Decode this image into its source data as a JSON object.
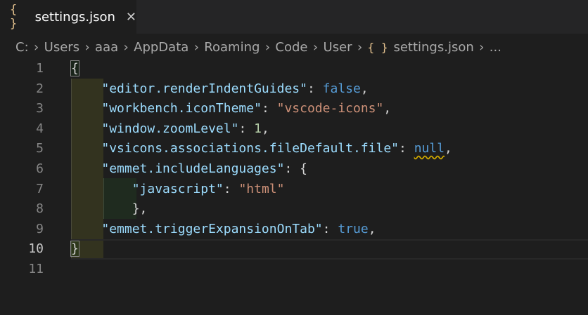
{
  "tab": {
    "icon": "{ }",
    "title": "settings.json",
    "close": "✕"
  },
  "breadcrumb": {
    "items": [
      "C:",
      "Users",
      "aaa",
      "AppData",
      "Roaming",
      "Code",
      "User"
    ],
    "file_icon": "{ }",
    "file": "settings.json",
    "ellipsis": "..."
  },
  "editor": {
    "lines": [
      {
        "n": "1",
        "tokens": [
          {
            "t": "p",
            "v": "{"
          }
        ]
      },
      {
        "n": "2",
        "tokens": [
          {
            "t": "p",
            "v": "    "
          },
          {
            "t": "key",
            "v": "\"editor.renderIndentGuides\""
          },
          {
            "t": "p",
            "v": ": "
          },
          {
            "t": "kw",
            "v": "false"
          },
          {
            "t": "p",
            "v": ","
          }
        ]
      },
      {
        "n": "3",
        "tokens": [
          {
            "t": "p",
            "v": "    "
          },
          {
            "t": "key",
            "v": "\"workbench.iconTheme\""
          },
          {
            "t": "p",
            "v": ": "
          },
          {
            "t": "str",
            "v": "\"vscode-icons\""
          },
          {
            "t": "p",
            "v": ","
          }
        ]
      },
      {
        "n": "4",
        "tokens": [
          {
            "t": "p",
            "v": "    "
          },
          {
            "t": "key",
            "v": "\"window.zoomLevel\""
          },
          {
            "t": "p",
            "v": ": "
          },
          {
            "t": "num",
            "v": "1"
          },
          {
            "t": "p",
            "v": ","
          }
        ]
      },
      {
        "n": "5",
        "tokens": [
          {
            "t": "p",
            "v": "    "
          },
          {
            "t": "key",
            "v": "\"vsicons.associations.fileDefault.file\""
          },
          {
            "t": "p",
            "v": ": "
          },
          {
            "t": "kwsq",
            "v": "null"
          },
          {
            "t": "p",
            "v": ","
          }
        ]
      },
      {
        "n": "6",
        "tokens": [
          {
            "t": "p",
            "v": "    "
          },
          {
            "t": "key",
            "v": "\"emmet.includeLanguages\""
          },
          {
            "t": "p",
            "v": ": {"
          }
        ]
      },
      {
        "n": "7",
        "tokens": [
          {
            "t": "p",
            "v": "        "
          },
          {
            "t": "key",
            "v": "\"javascript\""
          },
          {
            "t": "p",
            "v": ": "
          },
          {
            "t": "str",
            "v": "\"html\""
          }
        ]
      },
      {
        "n": "8",
        "tokens": [
          {
            "t": "p",
            "v": "        },"
          }
        ]
      },
      {
        "n": "9",
        "tokens": [
          {
            "t": "p",
            "v": "    "
          },
          {
            "t": "key",
            "v": "\"emmet.triggerExpansionOnTab\""
          },
          {
            "t": "p",
            "v": ": "
          },
          {
            "t": "kw",
            "v": "true"
          },
          {
            "t": "p",
            "v": ","
          }
        ]
      },
      {
        "n": "10",
        "tokens": [
          {
            "t": "br",
            "v": "}"
          }
        ],
        "active": true
      },
      {
        "n": "11",
        "tokens": []
      }
    ]
  },
  "colors": {
    "background": "#1e1e1e",
    "key": "#9cdcfe",
    "string": "#ce9178",
    "keyword": "#569cd6",
    "number": "#b5cea8"
  }
}
